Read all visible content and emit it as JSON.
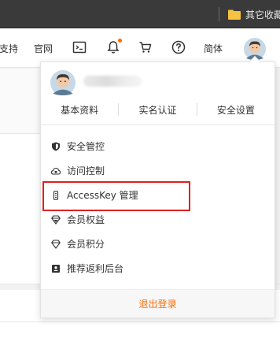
{
  "browser": {
    "bookmark_folder_label": "其它收藏",
    "folder_icon": "folder-icon",
    "folder_color": "#f5c242"
  },
  "header": {
    "nav_support": "支持",
    "nav_official_site": "官网",
    "nav_language": "简体",
    "icons": [
      "terminal-icon",
      "bell-icon",
      "cart-icon",
      "help-icon",
      "avatar"
    ],
    "notification_dot_color": "#ff6a00"
  },
  "dropdown": {
    "quick_links": [
      {
        "label": "基本资料"
      },
      {
        "label": "实名认证"
      },
      {
        "label": "安全设置"
      }
    ],
    "menu_items": [
      {
        "label": "安全管控",
        "icon": "shield-icon"
      },
      {
        "label": "访问控制",
        "icon": "cloud-icon"
      },
      {
        "label": "AccessKey 管理",
        "icon": "key-icon"
      },
      {
        "label": "会员权益",
        "icon": "diamond-icon"
      },
      {
        "label": "会员积分",
        "icon": "diamond-outline-icon"
      },
      {
        "label": "推荐返利后台",
        "icon": "id-card-icon"
      }
    ],
    "logout_label": "退出登录",
    "highlight_color": "#e02020",
    "accent_color": "#ff6a00"
  }
}
